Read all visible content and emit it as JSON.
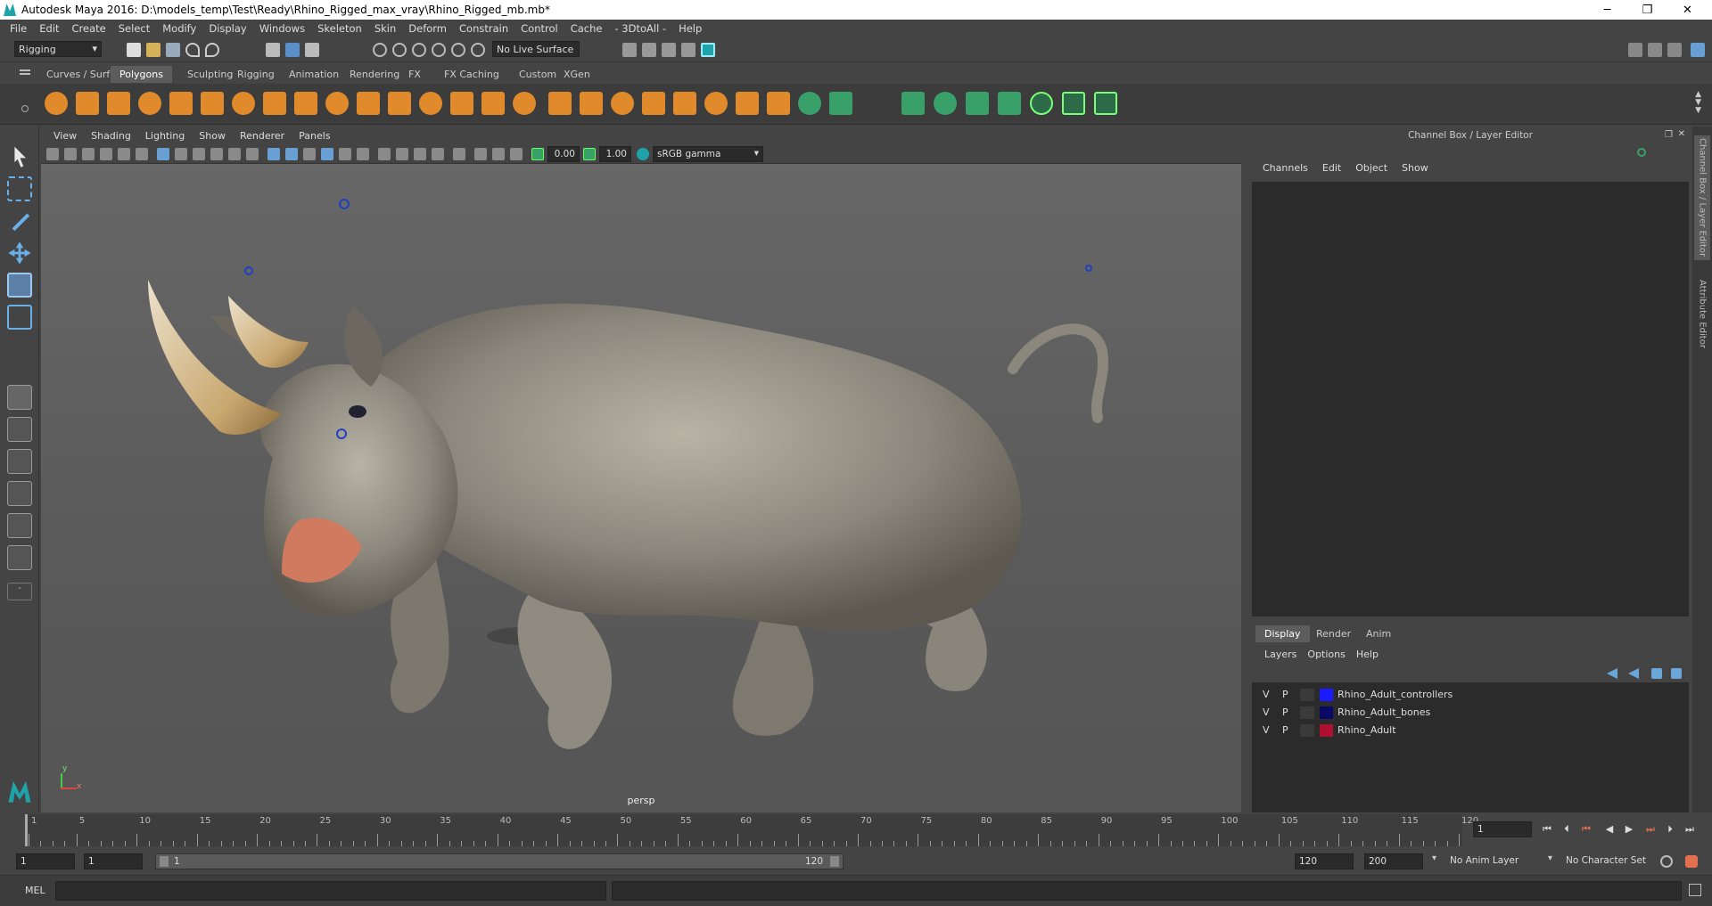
{
  "window": {
    "title": "Autodesk Maya 2016: D:\\models_temp\\Test\\Ready\\Rhino_Rigged_max_vray\\Rhino_Rigged_mb.mb*",
    "minimize_glyph": "─",
    "maximize_glyph": "❐",
    "close_glyph": "✕"
  },
  "menubar": [
    "File",
    "Edit",
    "Create",
    "Select",
    "Modify",
    "Display",
    "Windows",
    "Skeleton",
    "Skin",
    "Deform",
    "Constrain",
    "Control",
    "Cache",
    "- 3DtoAll -",
    "Help"
  ],
  "statusline": {
    "mode": "Rigging",
    "live_surface": "No Live Surface"
  },
  "shelf_tabs": [
    "Curves / Surfaces",
    "Polygons",
    "Sculpting",
    "Rigging",
    "Animation",
    "Rendering",
    "FX",
    "FX Caching",
    "Custom",
    "XGen"
  ],
  "shelf_active": "Polygons",
  "viewport": {
    "menu": [
      "View",
      "Shading",
      "Lighting",
      "Show",
      "Renderer",
      "Panels"
    ],
    "field1": "0.00",
    "field2": "1.00",
    "color_space": "sRGB gamma",
    "camera": "persp",
    "axis_y": "y",
    "axis_x": "x"
  },
  "channel_box": {
    "title": "Channel Box / Layer Editor",
    "menu": [
      "Channels",
      "Edit",
      "Object",
      "Show"
    ]
  },
  "side_tabs": [
    "Channel Box / Layer Editor",
    "Attribute Editor"
  ],
  "layer_editor": {
    "tabs": [
      "Display",
      "Render",
      "Anim"
    ],
    "active_tab": "Display",
    "menu": [
      "Layers",
      "Options",
      "Help"
    ],
    "layers": [
      {
        "v": "V",
        "p": "P",
        "name": "Rhino_Adult_controllers",
        "color": "#1a1aff"
      },
      {
        "v": "V",
        "p": "P",
        "name": "Rhino_Adult_bones",
        "color": "#0a0a66"
      },
      {
        "v": "V",
        "p": "P",
        "name": "Rhino_Adult",
        "color": "#b01030"
      }
    ]
  },
  "timeline": {
    "ticks": [
      "1",
      "5",
      "10",
      "15",
      "20",
      "25",
      "30",
      "35",
      "40",
      "45",
      "50",
      "55",
      "60",
      "65",
      "70",
      "75",
      "80",
      "85",
      "90",
      "95",
      "100",
      "105",
      "110",
      "115",
      "120"
    ],
    "current_frame": "1"
  },
  "range": {
    "start": "1",
    "playback_start": "1",
    "slider_start": "1",
    "slider_end": "120",
    "playback_end": "120",
    "end": "200",
    "anim_layer": "No Anim Layer",
    "character_set": "No Character Set"
  },
  "command_line": {
    "label": "MEL"
  },
  "colors": {
    "accent_teal": "#1fa3a8",
    "shelf_orange": "#e08a2c",
    "shelf_green": "#3aa06a"
  }
}
